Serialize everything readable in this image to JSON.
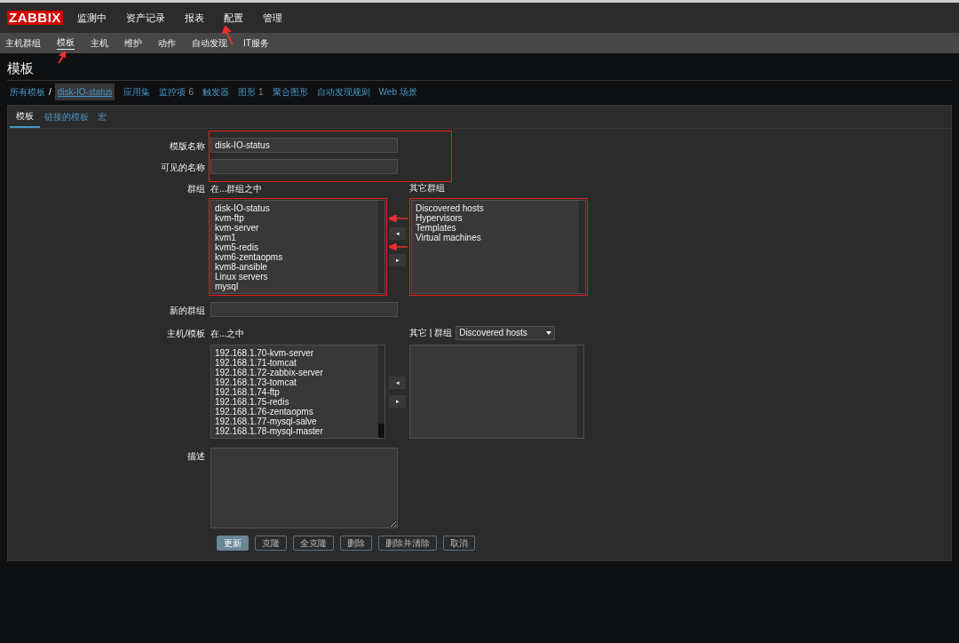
{
  "logo": "ZABBIX",
  "main_menu": [
    {
      "label": "监测中"
    },
    {
      "label": "资产记录"
    },
    {
      "label": "报表"
    },
    {
      "label": "配置"
    },
    {
      "label": "管理"
    }
  ],
  "sub_menu": [
    {
      "label": "主机群组",
      "selected": false
    },
    {
      "label": "模板",
      "selected": true
    },
    {
      "label": "主机",
      "selected": false
    },
    {
      "label": "维护",
      "selected": false
    },
    {
      "label": "动作",
      "selected": false
    },
    {
      "label": "自动发现",
      "selected": false
    },
    {
      "label": "IT服务",
      "selected": false
    }
  ],
  "page_title": "模板",
  "breadcrumb": {
    "root": "所有模板",
    "separator": "/",
    "current": "disk-IO-status",
    "links": [
      {
        "label": "应用集"
      },
      {
        "label": "监控项",
        "count": "6"
      },
      {
        "label": "触发器"
      },
      {
        "label": "图形",
        "count": "1"
      },
      {
        "label": "聚合图形"
      },
      {
        "label": "自动发现规则"
      },
      {
        "label": "Web 场景"
      }
    ]
  },
  "tabs": [
    {
      "label": "模板",
      "selected": true
    },
    {
      "label": "链接的模板",
      "selected": false
    },
    {
      "label": "宏",
      "selected": false
    }
  ],
  "form": {
    "template_name": {
      "label": "模版名称",
      "value": "disk-IO-status"
    },
    "visible_name": {
      "label": "可见的名称"
    },
    "groups": {
      "label": "群组",
      "in_title": "在...群组之中",
      "in_items": [
        "disk-IO-status",
        "kvm-ftp",
        "kvm-server",
        "kvm1",
        "kvm5-redis",
        "kvm6-zentaopms",
        "kvm8-ansible",
        "Linux servers",
        "mysql"
      ],
      "other_title": "其它群组",
      "other_items": [
        "Discovered hosts",
        "Hypervisors",
        "Templates",
        "Virtual machines"
      ],
      "move_left": "◂",
      "move_right": "▸"
    },
    "new_group": {
      "label": "新的群组"
    },
    "hosts": {
      "label": "主机/模板",
      "in_title": "在...之中",
      "in_items": [
        "192.168.1.70-kvm-server",
        "192.168.1.71-tomcat",
        "192.168.1.72-zabbix-server",
        "192.168.1.73-tomcat",
        "192.168.1.74-ftp",
        "192.168.1.75-redis",
        "192.168.1.76-zentaopms",
        "192.168.1.77-mysql-salve",
        "192.168.1.78-mysql-master"
      ],
      "other_title": "其它 | 群组",
      "group_select": "Discovered hosts",
      "move_left": "◂",
      "move_right": "▸"
    },
    "description": {
      "label": "描述"
    }
  },
  "buttons": [
    {
      "label": "更新",
      "kind": "primary"
    },
    {
      "label": "克隆",
      "kind": "secondary"
    },
    {
      "label": "全克隆",
      "kind": "secondary"
    },
    {
      "label": "删除",
      "kind": "secondary"
    },
    {
      "label": "删除并清除",
      "kind": "secondary"
    },
    {
      "label": "取消",
      "kind": "secondary"
    }
  ]
}
